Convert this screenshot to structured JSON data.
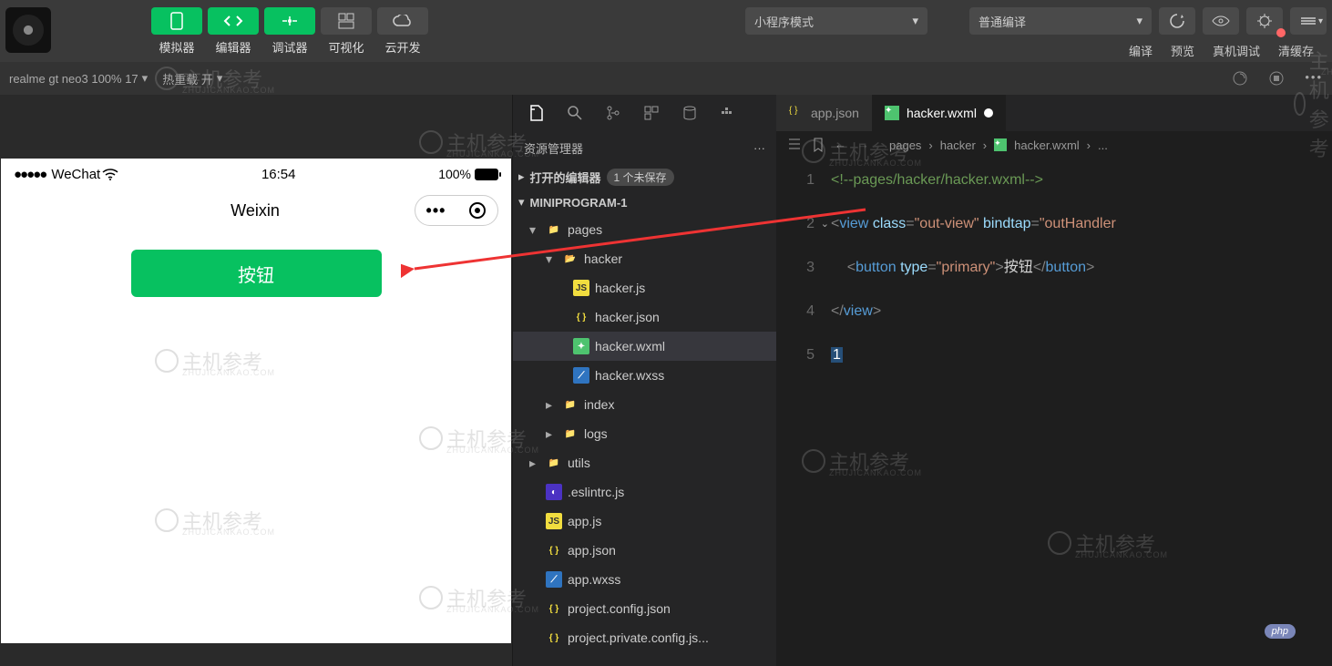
{
  "toolbar": {
    "simulator": "模拟器",
    "editor": "编辑器",
    "debugger": "调试器",
    "visualize": "可视化",
    "cloud": "云开发"
  },
  "top_dropdowns": {
    "mode": "小程序模式",
    "compile": "普通编译"
  },
  "top_right_labels": {
    "compile": "编译",
    "preview": "预览",
    "remote_debug": "真机调试",
    "clear_cache": "清缓存"
  },
  "subbar": {
    "device": "realme gt neo3 100% 17",
    "hot_reload": "热重载 开"
  },
  "simulator": {
    "carrier": "WeChat",
    "time": "16:54",
    "battery": "100%",
    "page_title": "Weixin",
    "button_text": "按钮"
  },
  "explorer": {
    "title": "资源管理器",
    "open_editors": "打开的编辑器",
    "unsaved_badge": "1 个未保存",
    "project": "MINIPROGRAM-1",
    "tree": {
      "pages": "pages",
      "hacker": "hacker",
      "hacker_js": "hacker.js",
      "hacker_json": "hacker.json",
      "hacker_wxml": "hacker.wxml",
      "hacker_wxss": "hacker.wxss",
      "index": "index",
      "logs": "logs",
      "utils": "utils",
      "eslintrc": ".eslintrc.js",
      "app_js": "app.js",
      "app_json": "app.json",
      "app_wxss": "app.wxss",
      "proj_config": "project.config.json",
      "proj_private": "project.private.config.js..."
    }
  },
  "editor_tabs": {
    "tab1": "app.json",
    "tab2": "hacker.wxml"
  },
  "breadcrumb": {
    "p1": "pages",
    "p2": "hacker",
    "p3": "hacker.wxml",
    "p4": "..."
  },
  "code": {
    "l1_comment": "<!--pages/hacker/hacker.wxml-->",
    "l2_tag_open": "<",
    "l2_tag": "view",
    "l2_attr1": "class",
    "l2_val1": "\"out-view\"",
    "l2_attr2": "bindtap",
    "l2_val2": "\"outHandler",
    "l3_tag": "button",
    "l3_attr": "type",
    "l3_val": "\"primary\"",
    "l3_text": "按钮",
    "l4_close": "view",
    "line_nums": [
      "1",
      "2",
      "3",
      "4",
      "5"
    ]
  },
  "watermark_text": "主机参考",
  "watermark_sub": "ZHUJICANKAO.COM",
  "php_badge": "php"
}
